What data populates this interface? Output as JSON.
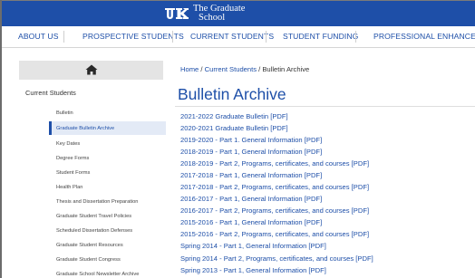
{
  "header": {
    "logo_line1": "The Graduate",
    "logo_line2": "School",
    "colors": {
      "brand_blue": "#1e4fa8",
      "white": "#ffffff"
    }
  },
  "nav": {
    "items": [
      {
        "label": "ABOUT US"
      },
      {
        "label": "PROSPECTIVE STUDENTS"
      },
      {
        "label": "CURRENT STUDENTS"
      },
      {
        "label": "STUDENT FUNDING"
      },
      {
        "label": "PROFESSIONAL ENHANCEMENT"
      }
    ]
  },
  "sidebar": {
    "home_icon": "home-icon",
    "title": "Current Students",
    "items": [
      {
        "label": "Bulletin"
      },
      {
        "label": "Graduate Bulletin Archive",
        "active": true
      },
      {
        "label": "Key Dates"
      },
      {
        "label": "Degree Forms"
      },
      {
        "label": "Student Forms"
      },
      {
        "label": "Health Plan"
      },
      {
        "label": "Thesis and Dissertation Preparation"
      },
      {
        "label": "Graduate Student Travel Policies"
      },
      {
        "label": "Scheduled Dissertation Defenses"
      },
      {
        "label": "Graduate Student Resources"
      },
      {
        "label": "Graduate Student Congress"
      },
      {
        "label": "Graduate School Newsletter Archive"
      }
    ]
  },
  "breadcrumb": {
    "home": "Home",
    "sep1": " / ",
    "section": "Current Students",
    "sep2": " / ",
    "current": "Bulletin Archive"
  },
  "main": {
    "title": "Bulletin Archive",
    "links": [
      "2021-2022 Graduate Bulletin [PDF]",
      "2020-2021 Graduate Bulletin [PDF]",
      "2019-2020 - Part 1. General Information [PDF]",
      "2018-2019 - Part 1, General Information [PDF]",
      "2018-2019 - Part 2, Programs, certificates, and courses [PDF]",
      "2017-2018 - Part 1, General Information [PDF]",
      "2017-2018 - Part 2, Programs, certificates, and courses [PDF]",
      "2016-2017 - Part 1, General Information [PDF]",
      "2016-2017 - Part 2, Programs, certificates, and courses [PDF]",
      "2015-2016 - Part 1, General Information [PDF]",
      "2015-2016 - Part 2, Programs, certificates, and courses [PDF]",
      "Spring 2014 - Part 1, General Information [PDF]",
      "Spring 2014 - Part 2, Programs, certificates, and courses [PDF]",
      "Spring 2013 - Part 1, General Information [PDF]"
    ]
  }
}
